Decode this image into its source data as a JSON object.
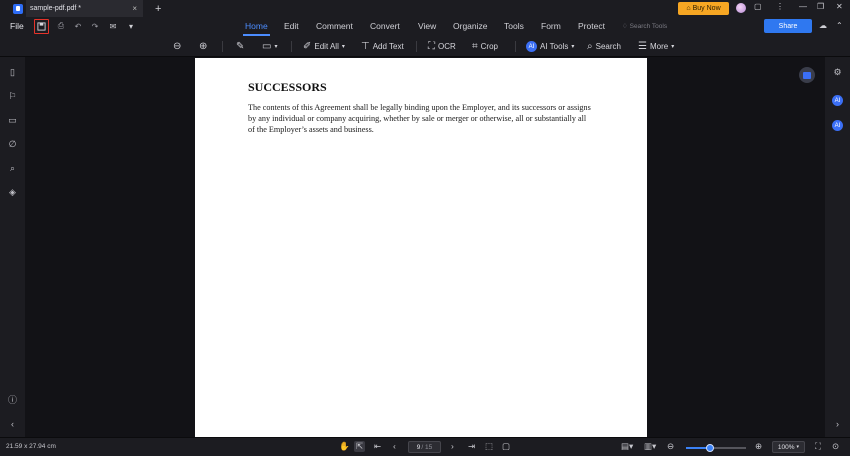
{
  "titlebar": {
    "tab_title": "sample-pdf.pdf *",
    "tab_close": "×",
    "new_tab": "+",
    "buy_now": "Buy Now",
    "buy_icon": "cart-icon",
    "icons": [
      "chat-icon",
      "kebab-menu-icon",
      "minimize-icon",
      "maximize-icon",
      "close-icon"
    ]
  },
  "menubar": {
    "file": "File",
    "quick_actions": [
      "save-icon",
      "print-icon",
      "undo-icon",
      "redo-icon",
      "mail-icon",
      "dropdown-icon"
    ],
    "tabs": [
      "Home",
      "Edit",
      "Comment",
      "Convert",
      "View",
      "Organize",
      "Tools",
      "Form",
      "Protect"
    ],
    "active_tab": "Home",
    "search_tools": "Search Tools",
    "share": "Share"
  },
  "toolbar": {
    "edit_all": "Edit All",
    "add_text": "Add Text",
    "ocr": "OCR",
    "crop": "Crop",
    "ai_badge": "AI",
    "ai_tools": "AI Tools",
    "search": "Search",
    "more": "More"
  },
  "document": {
    "heading": "SUCCESSORS",
    "paragraph": "The contents of this Agreement shall be legally binding upon the Employer, and its successors or assigns by any individual or company acquiring, whether by sale or merger or otherwise, all or substantially all of the Employer’s assets and business."
  },
  "rightrail": {
    "ai_badge": "AI"
  },
  "status": {
    "dimensions": "21.59 x 27.94 cm",
    "current_page": "9",
    "total_pages": "/ 15",
    "zoom": "100%",
    "zoom_level": 0.4
  },
  "colors": {
    "accent": "#2f78f0",
    "buy_now": "#f6a623",
    "save_highlight": "#e5332a"
  }
}
